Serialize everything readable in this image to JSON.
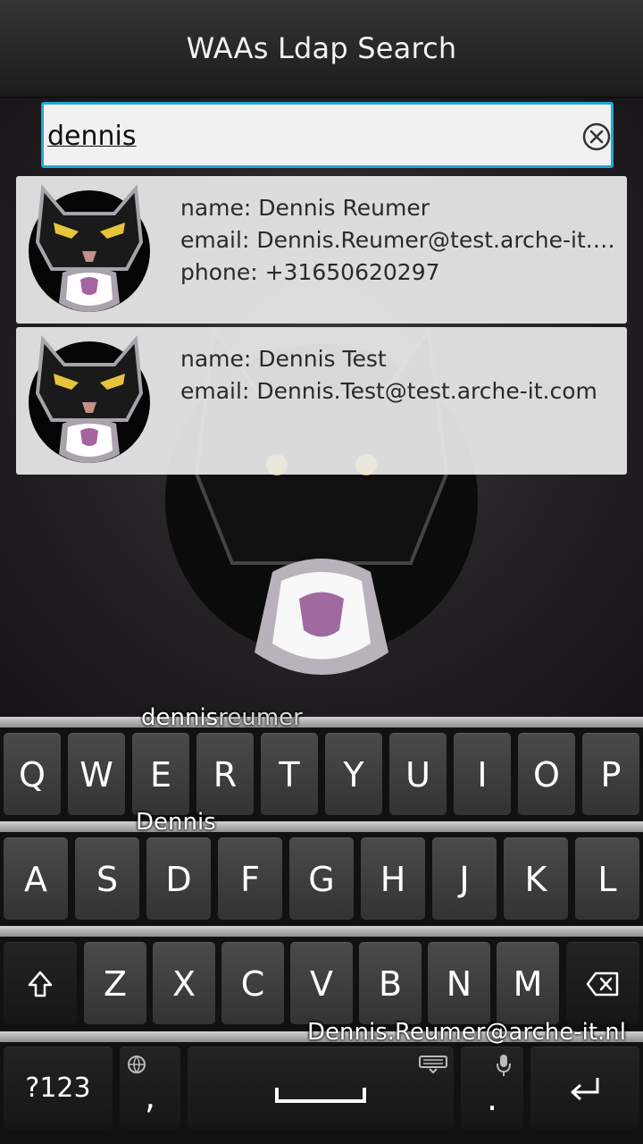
{
  "app": {
    "title": "WAAs Ldap Search"
  },
  "search": {
    "value": "dennis",
    "clear_icon": "clear-circle-icon"
  },
  "results": [
    {
      "name": "name: Dennis Reumer",
      "email": "email: Dennis.Reumer@test.arche-it.c...",
      "phone": "phone: +31650620297"
    },
    {
      "name": "name: Dennis Test",
      "email": "email: Dennis.Test@test.arche-it.com"
    }
  ],
  "keyboard": {
    "suggestions": {
      "s1_typed": "dennis",
      "s1_rest": "reumer",
      "s2": "Dennis",
      "s3": "Dennis.Reumer@arche-it.nl"
    },
    "row1": [
      "Q",
      "W",
      "E",
      "R",
      "T",
      "Y",
      "U",
      "I",
      "O",
      "P"
    ],
    "row2": [
      "A",
      "S",
      "D",
      "F",
      "G",
      "H",
      "J",
      "K",
      "L"
    ],
    "row3": [
      "Z",
      "X",
      "C",
      "V",
      "B",
      "N",
      "M"
    ],
    "symbols_label": "?123",
    "comma_label": ",",
    "period_label": ".",
    "icons": {
      "shift": "shift-icon",
      "backspace": "backspace-icon",
      "globe": "globe-icon",
      "space": "space-bar-icon",
      "keyboard": "keyboard-icon",
      "mic": "microphone-icon",
      "enter": "enter-icon"
    }
  }
}
